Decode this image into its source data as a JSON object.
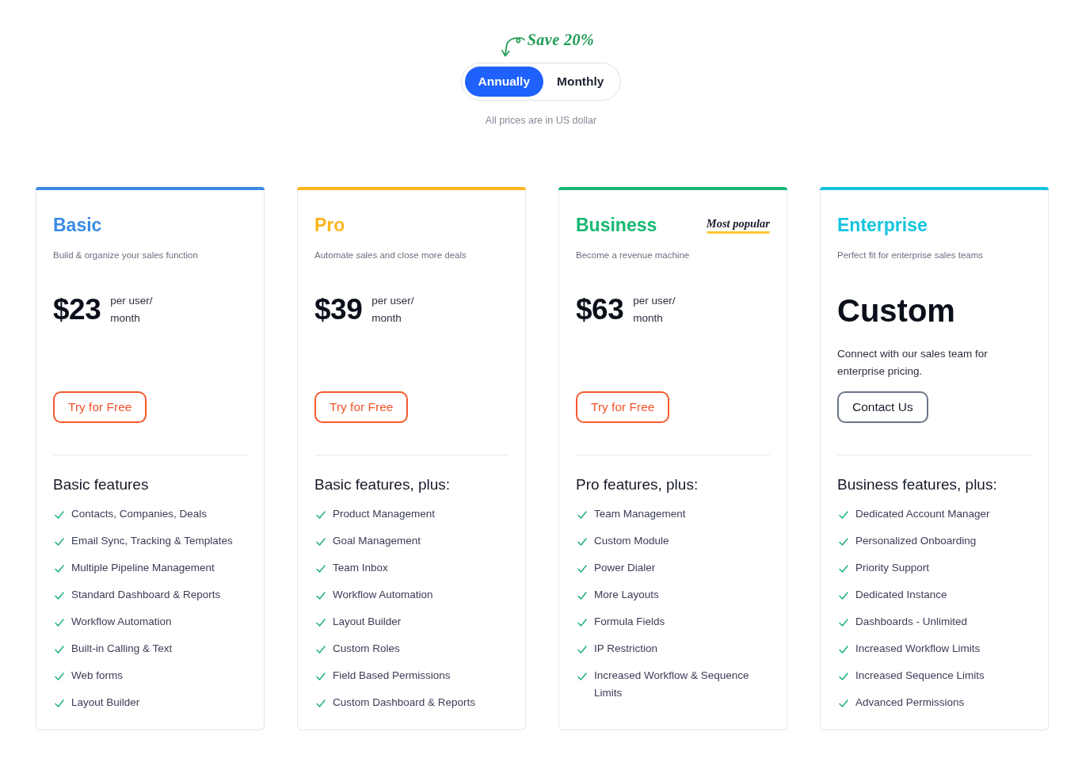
{
  "billing": {
    "badge": "Save 20%",
    "options": [
      {
        "label": "Annually",
        "selected": true
      },
      {
        "label": "Monthly",
        "selected": false
      }
    ],
    "note": "All prices are in US dollar"
  },
  "plans": [
    {
      "name": "Basic",
      "color": "#3a8be6",
      "kind": "priced",
      "tagline": "Build & organize your sales function",
      "price": "$23",
      "unit": "per user/ month",
      "button": "Try for Free",
      "features_heading": "Basic features",
      "features": [
        "Contacts, Companies, Deals",
        "Email Sync, Tracking & Templates",
        "Multiple Pipeline Management",
        "Standard Dashboard & Reports",
        "Workflow Automation",
        "Built-in Calling & Text",
        "Web forms",
        "Layout Builder"
      ]
    },
    {
      "name": "Pro",
      "color": "#fdb51e",
      "kind": "priced",
      "tagline": "Automate sales and close more deals",
      "price": "$39",
      "unit": "per user/ month",
      "button": "Try for Free",
      "features_heading": "Basic features, plus:",
      "features": [
        "Product Management",
        "Goal Management",
        "Team Inbox",
        "Workflow Automation",
        "Layout Builder",
        "Custom Roles",
        "Field Based Permissions",
        "Custom Dashboard & Reports"
      ]
    },
    {
      "name": "Business",
      "color": "#16b872",
      "kind": "priced",
      "badge": "Most popular",
      "tagline": "Become a revenue machine",
      "price": "$63",
      "unit": "per user/ month",
      "button": "Try for Free",
      "features_heading": "Pro features, plus:",
      "features": [
        "Team Management",
        "Custom Module",
        "Power Dialer",
        "More Layouts",
        "Formula Fields",
        "IP Restriction",
        "Increased Workflow & Sequence Limits"
      ]
    },
    {
      "name": "Enterprise",
      "color": "#16c4e0",
      "kind": "custom",
      "tagline": "Perfect fit for enterprise sales teams",
      "price": "Custom",
      "description": "Connect with our sales team for enterprise pricing.",
      "button": "Contact Us",
      "features_heading": "Business features, plus:",
      "features": [
        "Dedicated Account Manager",
        "Personalized Onboarding",
        "Priority Support",
        "Dedicated Instance",
        "Dashboards - Unlimited",
        "Increased Workflow Limits",
        "Increased Sequence Limits",
        "Advanced Permissions"
      ]
    }
  ]
}
